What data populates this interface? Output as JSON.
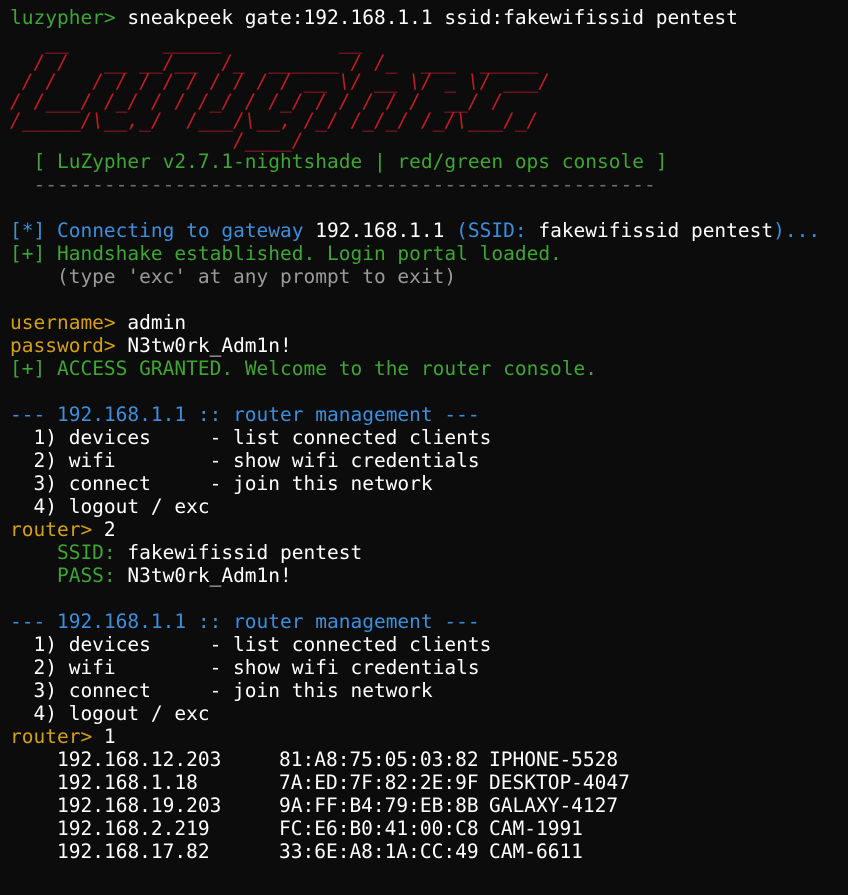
{
  "prompt": {
    "user": "luzypher>",
    "command": " sneakpeek gate:192.168.1.1 ssid:fakewifissid pentest"
  },
  "banner": {
    "ascii": [
      "   __        _____          __",
      "  / /   __ __/__  /_  ______ / /_  ___  _____",
      " / /   / / / / / / / / / __ \\/ __ \\/ _ \\/ ___/",
      "/ /___/ /_/ / / /_/ / /_/ / / / / /  __/ /",
      "/_____/\\__,_/  /___/\\__, /_/ /_/_/ /_/\\___/_/",
      "                   /____/"
    ],
    "version_line": "  [ LuZypher v2.7.1-nightshade | red/green ops console ]",
    "rule": "  -----------------------------------------------------"
  },
  "connect": {
    "tag": "[*]",
    "text": " Connecting to gateway ",
    "gateway": "192.168.1.1",
    "ssid_open": " (SSID: ",
    "ssid": "fakewifissid pentest",
    "ssid_close": ")..."
  },
  "handshake": {
    "tag": "[+]",
    "text": " Handshake established. Login portal loaded."
  },
  "hint": "    (type 'exc' at any prompt to exit)",
  "login": {
    "username_label": "username>",
    "username_value": " admin",
    "password_label": "password>",
    "password_value": " N3tw0rk_Adm1n!",
    "granted_tag": "[+]",
    "granted_text": " ACCESS GRANTED. Welcome to the router console."
  },
  "menu": {
    "header_dash_l": "--- ",
    "header_title": "192.168.1.1 :: router management",
    "header_dash_r": " ---",
    "items": [
      "  1) devices     - list connected clients",
      "  2) wifi        - show wifi credentials",
      "  3) connect     - join this network",
      "  4) logout / exc"
    ]
  },
  "router_prompt": "router>",
  "session": {
    "choice1": " 2",
    "ssid_label": "    SSID:",
    "ssid_value": " fakewifissid pentest",
    "pass_label": "    PASS:",
    "pass_value": " N3tw0rk_Adm1n!",
    "choice2": " 1"
  },
  "devices": [
    {
      "ip": "192.168.12.203",
      "mac": "81:A8:75:05:03:82",
      "name": "IPHONE-5528"
    },
    {
      "ip": "192.168.1.18",
      "mac": "7A:ED:7F:82:2E:9F",
      "name": "DESKTOP-4047"
    },
    {
      "ip": "192.168.19.203",
      "mac": "9A:FF:B4:79:EB:8B",
      "name": "GALAXY-4127"
    },
    {
      "ip": "192.168.2.219",
      "mac": "FC:E6:B0:41:00:C8",
      "name": "CAM-1991"
    },
    {
      "ip": "192.168.17.82",
      "mac": "33:6E:A8:1A:CC:49",
      "name": "CAM-6611"
    }
  ],
  "colors": {
    "background": "#0c0c0c",
    "prompt_green": "#3fa534",
    "info_blue": "#3d8fdc",
    "label_yellow": "#d4a017",
    "banner_red": "#c01c28"
  }
}
